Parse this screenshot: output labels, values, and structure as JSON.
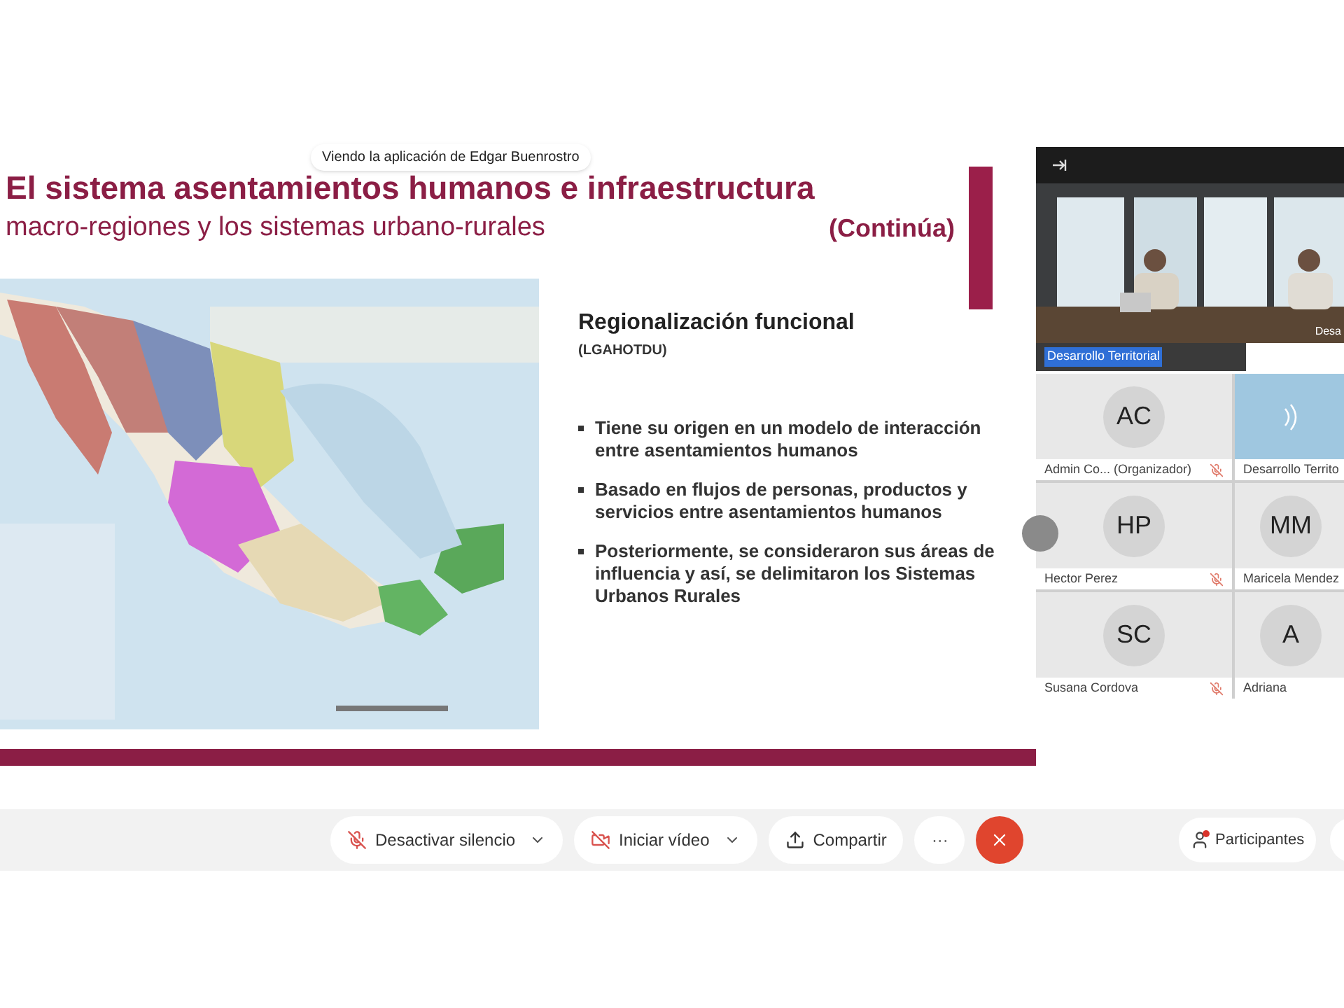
{
  "banner": "Viendo la aplicación de Edgar Buenrostro",
  "slide": {
    "title": "El sistema asentamientos humanos e infraestructura",
    "subtitle": "macro-regiones y los sistemas urbano-rurales",
    "continued": "(Continúa)",
    "heading": "Regionalización funcional",
    "subheading": "(LGAHOTDU)",
    "bullets": [
      "Tiene su origen en un modelo de interacción entre asentamientos humanos",
      "Basado en flujos de personas, productos y servicios entre asentamientos humanos",
      "Posteriormente, se consideraron sus áreas de influencia y así, se delimitaron los Sistemas Urbanos Rurales"
    ]
  },
  "video": {
    "name": "Desarrollo Territorial",
    "name_selected": true,
    "side_name": "Desa"
  },
  "participants": [
    {
      "initials": "AC",
      "name": "Admin Co... (Organizador)",
      "muted": true,
      "speaking": false
    },
    {
      "name": "Desarrollo Territo",
      "muted": false,
      "speaking": true
    },
    {
      "initials": "HP",
      "name": "Hector Perez",
      "muted": true,
      "speaking": false
    },
    {
      "initials": "MM",
      "name": "Maricela Mendez",
      "muted": false,
      "speaking": false
    },
    {
      "initials": "SC",
      "name": "Susana Cordova",
      "muted": true,
      "speaking": false
    },
    {
      "initials": "A",
      "name": "Adriana",
      "muted": false,
      "speaking": false
    }
  ],
  "toolbar": [
    {
      "kind": "mic",
      "label": "Desactivar silencio",
      "menu": true
    },
    {
      "kind": "video",
      "label": "Iniciar vídeo",
      "menu": true
    },
    {
      "kind": "share",
      "label": "Compartir",
      "menu": false
    },
    {
      "kind": "more",
      "label": "···"
    },
    {
      "kind": "leave"
    }
  ],
  "participants_button": {
    "label": "Participantes",
    "alert": true
  }
}
